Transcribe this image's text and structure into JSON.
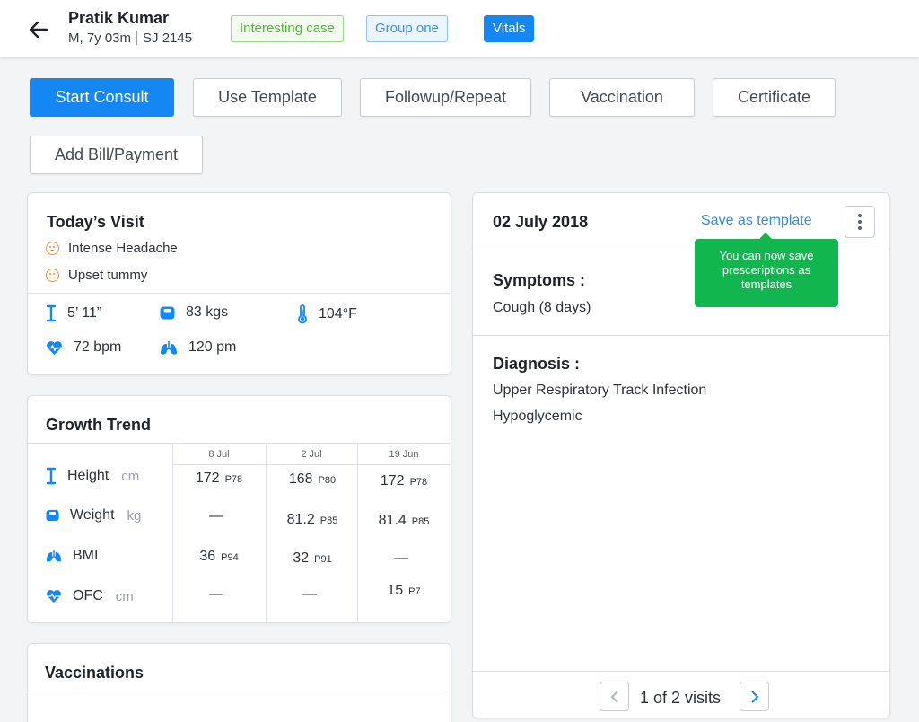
{
  "header": {
    "patient_name": "Pratik Kumar",
    "patient_age": "M, 7y 03m",
    "patient_id": "SJ 2145",
    "tags": [
      "Interesting case",
      "Group one"
    ],
    "vitals_tab": "Vitals",
    "icons": {
      "back": "back-arrow-icon"
    }
  },
  "actions": {
    "start_consult": "Start Consult",
    "use_template": "Use Template",
    "followup": "Followup/Repeat",
    "vaccination": "Vaccination",
    "certificate": "Certificate",
    "add_bill": "Add Bill/Payment"
  },
  "todays_visit": {
    "title": "Today’s Visit",
    "symptoms": [
      "Intense Headache",
      "Upset tummy"
    ],
    "vitals": {
      "height": "5’ 11”",
      "weight": "83 kgs",
      "temperature": "104°F",
      "heart_rate": "72 bpm",
      "respiration": "120 pm"
    }
  },
  "growth_trend": {
    "title": "Growth Trend",
    "dates": [
      "8 Jul",
      "2 Jul",
      "19 Jun"
    ],
    "rows": [
      {
        "label": "Height",
        "unit": "cm",
        "cells": [
          {
            "v": "172",
            "p": "P78"
          },
          {
            "v": "168",
            "p": "P80"
          },
          {
            "v": "172",
            "p": "P78"
          }
        ]
      },
      {
        "label": "Weight",
        "unit": "kg",
        "cells": [
          {
            "v": "—",
            "p": ""
          },
          {
            "v": "81.2",
            "p": "P85"
          },
          {
            "v": "81.4",
            "p": "P85"
          }
        ]
      },
      {
        "label": "BMI",
        "unit": "",
        "cells": [
          {
            "v": "36",
            "p": "P94"
          },
          {
            "v": "32",
            "p": "P91"
          },
          {
            "v": "—",
            "p": ""
          }
        ]
      },
      {
        "label": "OFC",
        "unit": "cm",
        "cells": [
          {
            "v": "—",
            "p": ""
          },
          {
            "v": "—",
            "p": ""
          },
          {
            "v": "15",
            "p": "P7"
          }
        ]
      }
    ]
  },
  "vaccinations": {
    "title": "Vaccinations"
  },
  "visit_detail": {
    "date": "02 July 2018",
    "save_template": "Save as template",
    "tooltip": "You can now save presceriptions as templates",
    "symptoms_title": "Symptoms :",
    "symptoms": [
      "Cough (8 days)"
    ],
    "diagnosis_title": "Diagnosis :",
    "diagnosis": [
      "Upper Respiratory Track Infection",
      "Hypoglycemic"
    ],
    "pager": "1 of 2 visits"
  },
  "colors": {
    "primary": "#1587f3",
    "success": "#12b64f",
    "tag_green": "#53b13c",
    "tag_blue": "#3b94d9",
    "symptom": "#f08a3c"
  }
}
